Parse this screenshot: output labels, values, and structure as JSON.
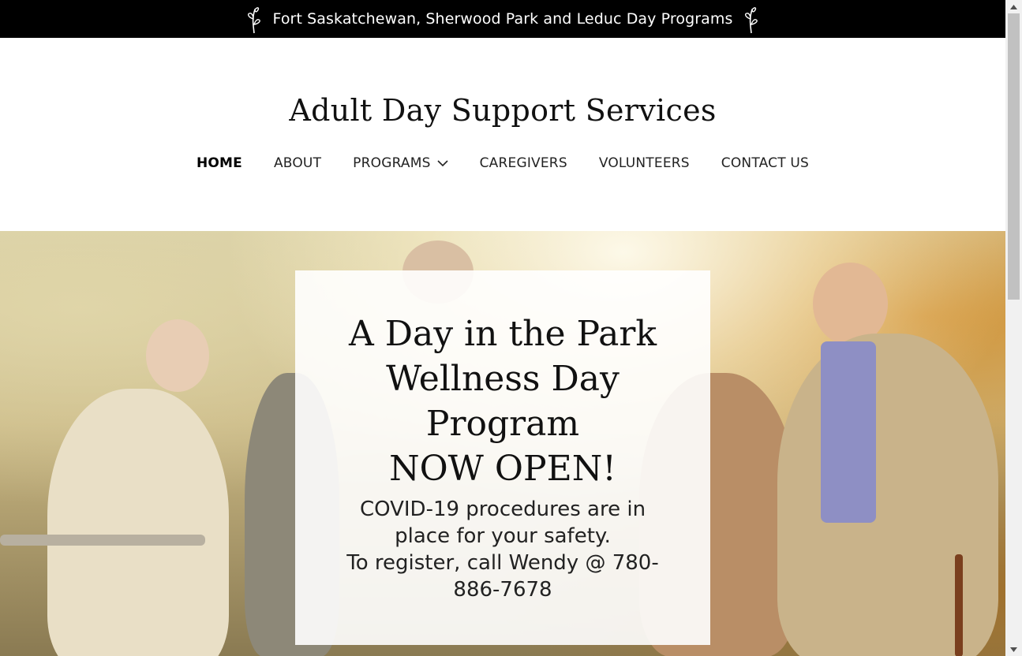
{
  "announcement": {
    "text": "Fort Saskatchewan, Sherwood Park and Leduc Day Programs"
  },
  "header": {
    "site_title": "Adult Day Support Services"
  },
  "nav": {
    "items": [
      {
        "label": "HOME",
        "active": true
      },
      {
        "label": "ABOUT",
        "active": false
      },
      {
        "label": "PROGRAMS",
        "active": false,
        "has_dropdown": true
      },
      {
        "label": "CAREGIVERS",
        "active": false
      },
      {
        "label": "VOLUNTEERS",
        "active": false
      },
      {
        "label": "CONTACT US",
        "active": false
      }
    ]
  },
  "hero": {
    "heading_lines": [
      "A Day in the Park",
      "Wellness Day",
      "Program",
      "NOW OPEN!"
    ],
    "body_lines": [
      "COVID-19 procedures are in",
      "place for your safety.",
      "To register, call Wendy @ 780-",
      "886-7678"
    ]
  },
  "colors": {
    "topbar_bg": "#000000",
    "text_dark": "#111111",
    "card_bg": "#ffffff"
  },
  "icons": [
    "sprig-icon",
    "chevron-down-icon",
    "scroll-up-arrow-icon",
    "scroll-down-arrow-icon"
  ]
}
